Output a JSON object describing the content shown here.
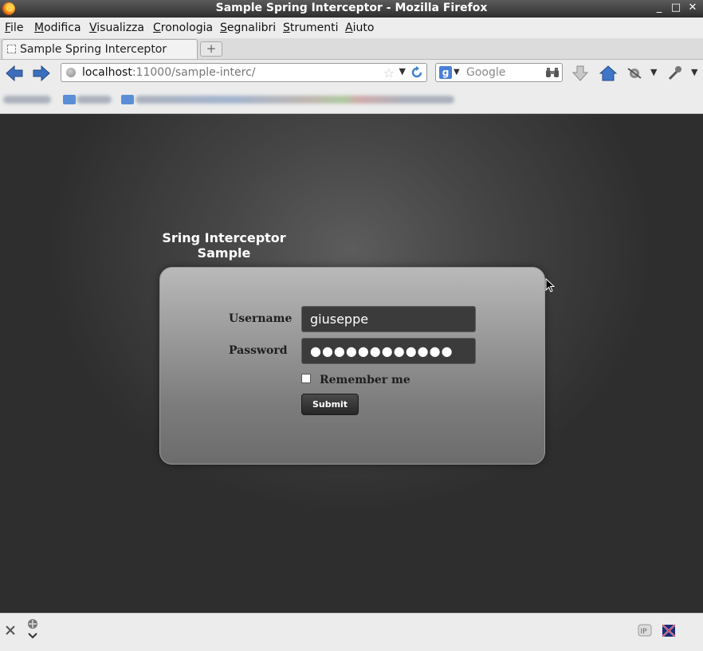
{
  "window": {
    "title": "Sample Spring Interceptor - Mozilla Firefox",
    "minimize_glyph": "_",
    "maximize_glyph": "□",
    "close_glyph": "✕"
  },
  "menu": {
    "items": [
      {
        "accel": "F",
        "rest": "ile"
      },
      {
        "accel": "M",
        "rest": "odifica"
      },
      {
        "accel": "V",
        "rest": "isualizza"
      },
      {
        "accel": "C",
        "rest": "ronologia"
      },
      {
        "accel": "S",
        "rest": "egnalibri"
      },
      {
        "accel": "S",
        "rest": "trumenti"
      },
      {
        "accel": "A",
        "rest": "iuto"
      }
    ]
  },
  "tabs": {
    "active_label": "Sample Spring Interceptor",
    "new_tab_glyph": "+"
  },
  "navbar": {
    "url_host": "localhost",
    "url_rest": ":11000/sample-interc/",
    "search_placeholder": "Google",
    "search_engine_glyph": "g"
  },
  "page": {
    "heading": "Sring Interceptor Sample",
    "username_label": "Username",
    "username_value": "giuseppe",
    "password_label": "Password",
    "password_value": "●●●●●●●●●●●●",
    "remember_label": "Remember me",
    "remember_checked": false,
    "submit_label": "Submit"
  },
  "icons": {
    "back": "back-arrow-icon",
    "forward": "forward-arrow-icon",
    "reload": "reload-icon",
    "bookmark_star": "star-icon",
    "download": "download-arrow-icon",
    "home": "home-icon",
    "status_close": "close-icon"
  },
  "colors": {
    "title_bar": "#2e2e2e",
    "page_background": "#3a3a3a",
    "panel": "#9a9a9a",
    "input_background": "#3b3b3b",
    "nav_arrow": "#3b6fbd"
  }
}
